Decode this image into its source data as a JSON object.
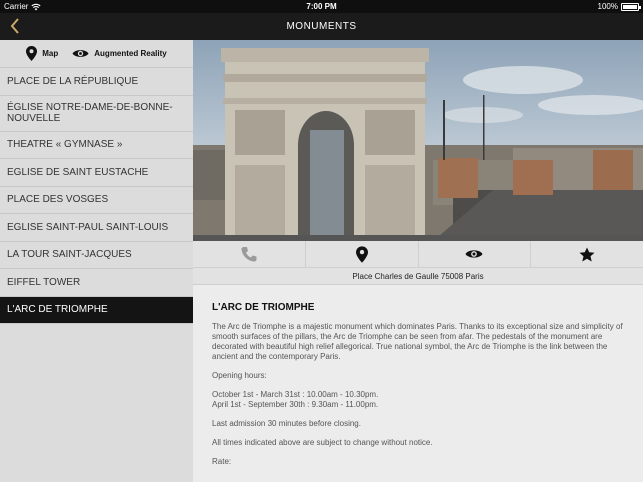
{
  "status": {
    "carrier": "Carrier",
    "time": "7:00 PM",
    "battery": "100%"
  },
  "nav": {
    "title": "MONUMENTS"
  },
  "modes": {
    "map_label": "Map",
    "ar_label": "Augmented Reality"
  },
  "sidebar": {
    "items": [
      {
        "label": "PLACE DE LA RÉPUBLIQUE"
      },
      {
        "label": "ÉGLISE NOTRE-DAME-DE-BONNE-NOUVELLE"
      },
      {
        "label": "THEATRE « GYMNASE »"
      },
      {
        "label": "EGLISE DE SAINT EUSTACHE"
      },
      {
        "label": "PLACE DES VOSGES"
      },
      {
        "label": "EGLISE SAINT-PAUL SAINT-LOUIS"
      },
      {
        "label": "LA TOUR SAINT-JACQUES"
      },
      {
        "label": "EIFFEL TOWER"
      },
      {
        "label": "L'ARC DE TRIOMPHE"
      }
    ]
  },
  "detail": {
    "address": "Place Charles de Gaulle 75008 Paris",
    "title": "L'ARC DE TRIOMPHE",
    "description": "The Arc de Triomphe is a majestic monument which dominates Paris. Thanks to its exceptional size and simplicity of smooth surfaces of the pillars, the Arc de Triomphe can be seen from afar. The pedestals of the monument are decorated with beautiful high relief allegorical. True national symbol, the Arc de Triomphe is the link between the ancient and the contemporary Paris.",
    "hours_title": "Opening hours:",
    "hours_1": "October 1st - March 31st : 10.00am - 10.30pm.",
    "hours_2": "April 1st - September 30th : 9.30am - 11.00pm.",
    "last_admission": "Last admission 30 minutes before closing.",
    "notice": "All times indicated above are subject to change without notice.",
    "rate": "Rate:"
  },
  "icons": {
    "back": "chevron-left-icon",
    "map": "map-pin-icon",
    "ar": "eye-icon",
    "phone": "phone-icon",
    "location": "map-pin-icon",
    "view": "eye-icon",
    "favorite": "star-icon"
  },
  "colors": {
    "accent": "#c9a86a",
    "selected_bg": "#141414",
    "sidebar_bg": "#dcdcdc"
  }
}
